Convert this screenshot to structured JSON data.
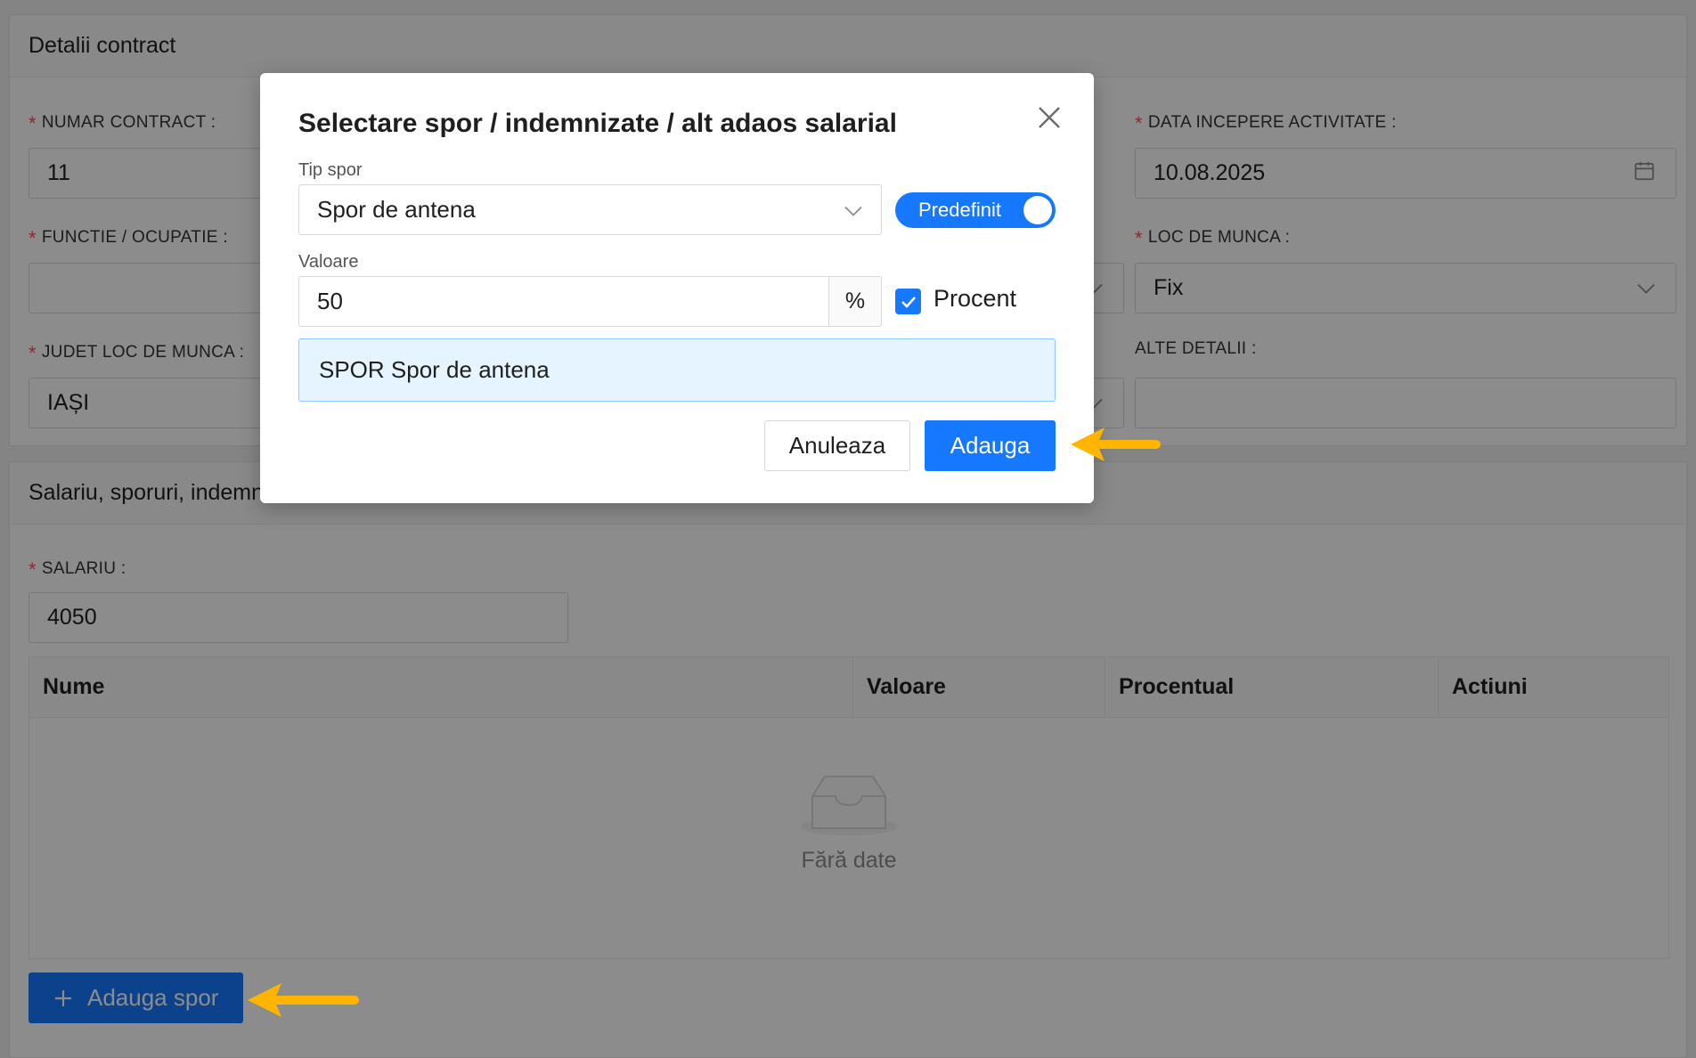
{
  "contract_card": {
    "title": "Detalii contract",
    "fields": {
      "numar_contract": {
        "label": "NUMAR CONTRACT :",
        "value": "11"
      },
      "data_incepere": {
        "label": "DATA INCEPERE ACTIVITATE :",
        "value": "10.08.2025"
      },
      "functie": {
        "label": "FUNCTIE / OCUPATIE :",
        "value": ""
      },
      "loc_munca": {
        "label": "LOC DE MUNCA :",
        "value": "Fix"
      },
      "judet": {
        "label": "JUDET LOC DE MUNCA :",
        "value": "IAȘI"
      },
      "alte_detalii": {
        "label": "ALTE DETALII :",
        "value": ""
      }
    }
  },
  "salary_card": {
    "title": "Salariu, sporuri, indemnizatii",
    "salariu_label": "SALARIU :",
    "salariu_value": "4050",
    "table": {
      "columns": [
        "Nume",
        "Valoare",
        "Procentual",
        "Actiuni"
      ],
      "empty_text": "Fără date"
    },
    "add_button": "Adauga spor"
  },
  "modal": {
    "title": "Selectare spor / indemnizate / alt adaos salarial",
    "tip_label": "Tip spor",
    "tip_value": "Spor de antena",
    "toggle_label": "Predefinit",
    "toggle_on": true,
    "valoare_label": "Valoare",
    "valoare_value": "50",
    "addon": "%",
    "procent_label": "Procent",
    "procent_checked": true,
    "preview": "SPOR Spor de antena",
    "cancel": "Anuleaza",
    "ok": "Adauga"
  },
  "colors": {
    "primary": "#1677ff",
    "annotation_arrow": "#ffb400",
    "required": "#ff4d4f"
  }
}
